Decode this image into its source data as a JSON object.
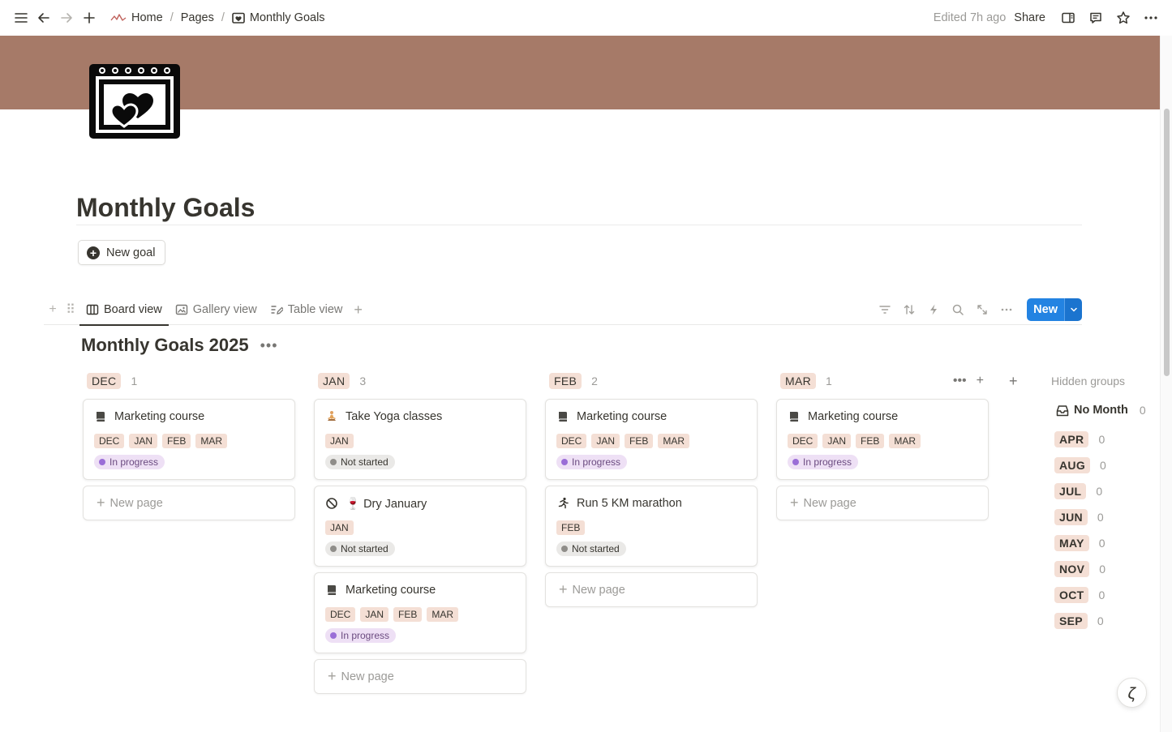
{
  "topbar": {
    "breadcrumbs": [
      "Home",
      "Pages",
      "Monthly Goals"
    ],
    "edited": "Edited 7h ago",
    "share": "Share"
  },
  "page": {
    "title": "Monthly Goals",
    "new_goal": "New goal",
    "cover_color": "#a67a68"
  },
  "views": {
    "tabs": [
      "Board view",
      "Gallery view",
      "Table view"
    ],
    "active": "Board view",
    "new_button": "New"
  },
  "board": {
    "title": "Monthly Goals 2025",
    "new_page_label": "New page",
    "columns": [
      {
        "month": "DEC",
        "count": "1",
        "cards": [
          {
            "title": "Marketing course",
            "icon": "book-icon",
            "tags": [
              "DEC",
              "JAN",
              "FEB",
              "MAR"
            ],
            "status": "In progress"
          }
        ]
      },
      {
        "month": "JAN",
        "count": "3",
        "cards": [
          {
            "title": "Take Yoga classes",
            "icon": "yoga-icon",
            "tags": [
              "JAN"
            ],
            "status": "Not started"
          },
          {
            "title": "🍷 Dry January",
            "icon": "prohibited-icon",
            "tags": [
              "JAN"
            ],
            "status": "Not started"
          },
          {
            "title": "Marketing course",
            "icon": "book-icon",
            "tags": [
              "DEC",
              "JAN",
              "FEB",
              "MAR"
            ],
            "status": "In progress"
          }
        ]
      },
      {
        "month": "FEB",
        "count": "2",
        "cards": [
          {
            "title": "Marketing course",
            "icon": "book-icon",
            "tags": [
              "DEC",
              "JAN",
              "FEB",
              "MAR"
            ],
            "status": "In progress"
          },
          {
            "title": "Run 5 KM marathon",
            "icon": "runner-icon",
            "tags": [
              "FEB"
            ],
            "status": "Not started"
          }
        ]
      },
      {
        "month": "MAR",
        "count": "1",
        "cards": [
          {
            "title": "Marketing course",
            "icon": "book-icon",
            "tags": [
              "DEC",
              "JAN",
              "FEB",
              "MAR"
            ],
            "status": "In progress"
          }
        ]
      }
    ]
  },
  "hidden_groups": {
    "title": "Hidden groups",
    "no_month": {
      "label": "No Month",
      "count": "0"
    },
    "groups": [
      {
        "month": "APR",
        "count": "0"
      },
      {
        "month": "AUG",
        "count": "0"
      },
      {
        "month": "JUL",
        "count": "0"
      },
      {
        "month": "JUN",
        "count": "0"
      },
      {
        "month": "MAY",
        "count": "0"
      },
      {
        "month": "NOV",
        "count": "0"
      },
      {
        "month": "OCT",
        "count": "0"
      },
      {
        "month": "SEP",
        "count": "0"
      }
    ]
  },
  "colors": {
    "tag_bg": "#f4dfd5",
    "accent": "#2383e2",
    "in_progress_bg": "#eee0f5",
    "not_started_bg": "#eae9e7"
  }
}
